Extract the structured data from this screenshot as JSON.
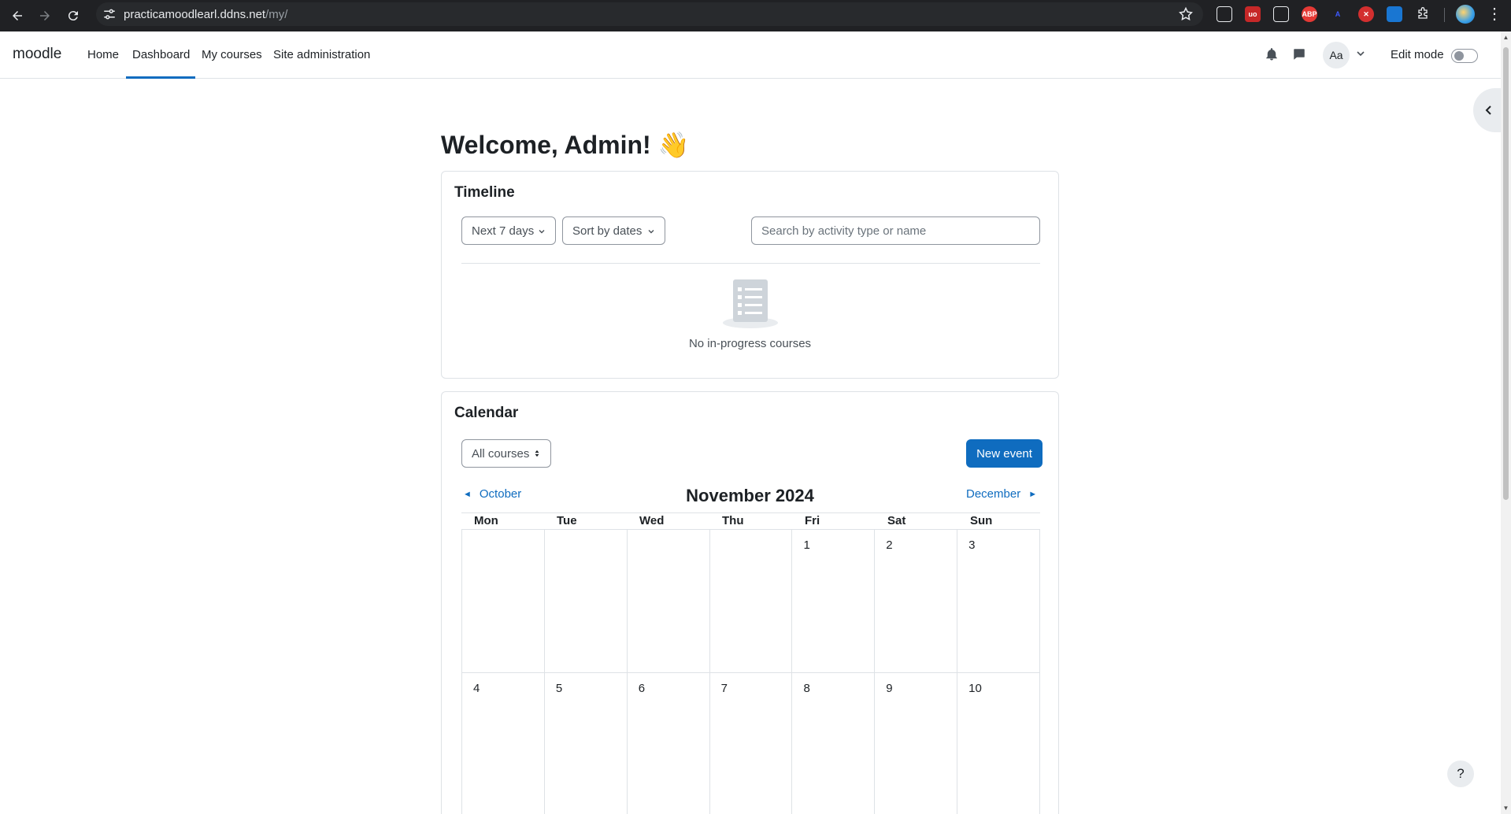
{
  "browser": {
    "url_host": "practicamoodlearl.ddns.net",
    "url_path": "/my/"
  },
  "navbar": {
    "brand": "moodle",
    "links": [
      "Home",
      "Dashboard",
      "My courses",
      "Site administration"
    ],
    "active_link": "Dashboard",
    "user_initials": "Aa",
    "edit_mode_label": "Edit mode",
    "edit_mode_on": false
  },
  "page": {
    "title": "Welcome, Admin! 👋"
  },
  "timeline": {
    "title": "Timeline",
    "filter_label": "Next 7 days",
    "sort_label": "Sort by dates",
    "search_placeholder": "Search by activity type or name",
    "empty_message": "No in-progress courses"
  },
  "calendar": {
    "title": "Calendar",
    "course_filter": "All courses",
    "new_event_label": "New event",
    "prev_month": "October",
    "next_month": "December",
    "month_title": "November 2024",
    "weekdays": [
      "Mon",
      "Tue",
      "Wed",
      "Thu",
      "Fri",
      "Sat",
      "Sun"
    ],
    "weeks": [
      [
        "",
        "",
        "",
        "",
        "1",
        "2",
        "3"
      ],
      [
        "4",
        "5",
        "6",
        "7",
        "8",
        "9",
        "10"
      ]
    ]
  },
  "help": {
    "label": "?"
  },
  "colors": {
    "accent": "#0f6cbf",
    "browser_bar": "#202124",
    "border": "#dee2e6"
  }
}
